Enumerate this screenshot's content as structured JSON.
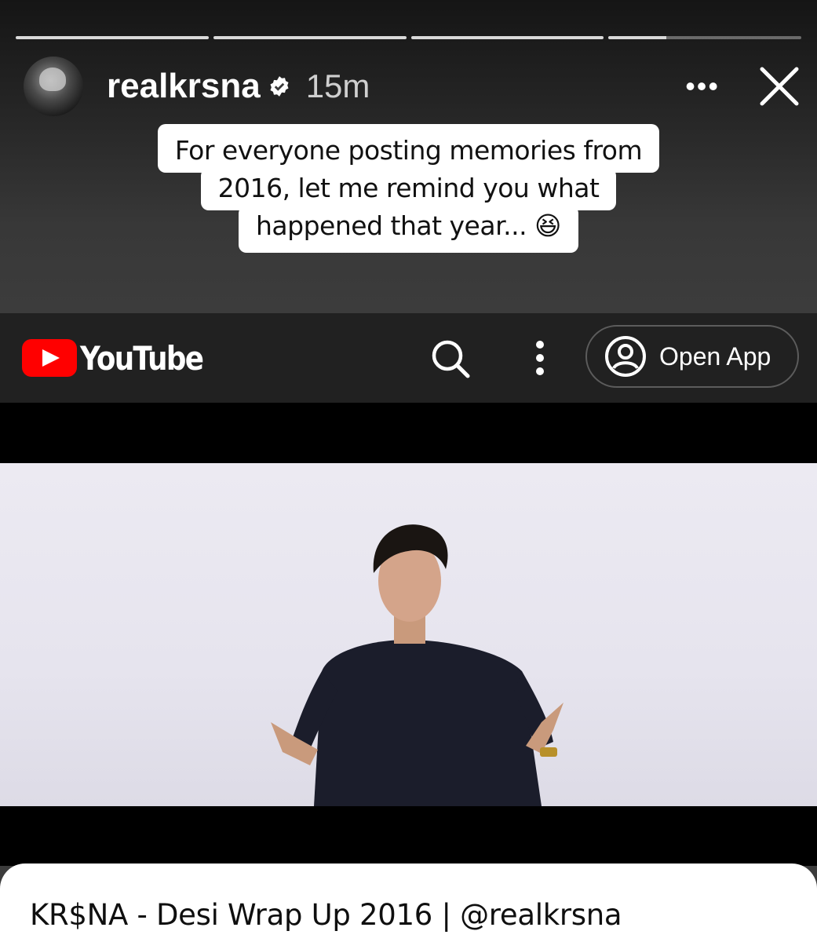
{
  "story": {
    "progress": [
      "done",
      "done",
      "done",
      "active"
    ],
    "username": "realkrsna",
    "verified_icon": "verified-badge-icon",
    "time": "15m",
    "more_icon": "more-horizontal-icon",
    "more_glyph": "•••",
    "close_icon": "close-icon",
    "caption_lines": [
      "For everyone posting memories from",
      "2016, let me remind you what",
      "happened that year... 😆"
    ]
  },
  "youtube": {
    "logo_text": "YouTube",
    "search_icon": "search-icon",
    "menu_icon": "vertical-dots-icon",
    "open_app_label": "Open App",
    "account_icon": "account-circle-icon",
    "video_title": "KR$NA - Desi Wrap Up 2016 | @realkrsna",
    "colors": {
      "brand_red": "#ff0000",
      "bar": "#212121"
    }
  }
}
